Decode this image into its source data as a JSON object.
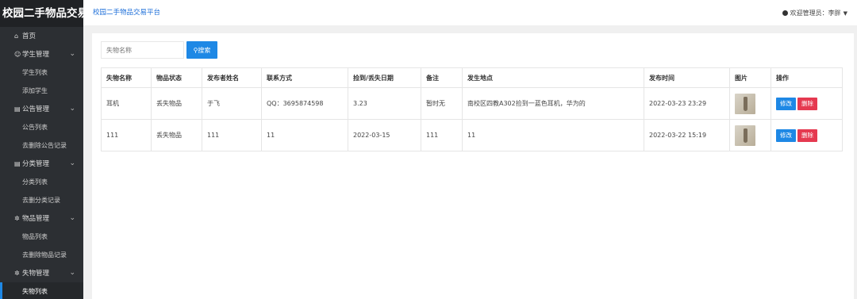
{
  "app": {
    "brand": "校园二手物品交易"
  },
  "topbar": {
    "crumb": "校园二手物品交易平台",
    "user": "欢迎管理员：李胖"
  },
  "sidebar": {
    "home": "首页",
    "groups": [
      {
        "label": "学生管理",
        "icon": "users-icon",
        "items": [
          "学生列表",
          "添加学生"
        ]
      },
      {
        "label": "公告管理",
        "icon": "document-icon",
        "items": [
          "公告列表",
          "去删除公告记录"
        ]
      },
      {
        "label": "分类管理",
        "icon": "document-icon",
        "items": [
          "分类列表",
          "去删分类记录"
        ]
      },
      {
        "label": "物品管理",
        "icon": "gear-icon",
        "items": [
          "物品列表",
          "去删除物品记录"
        ]
      },
      {
        "label": "失物管理",
        "icon": "gear-icon",
        "items": [
          "失物列表"
        ]
      }
    ],
    "active_item": "失物列表"
  },
  "search": {
    "placeholder": "失物名称",
    "button": "搜索"
  },
  "table": {
    "headers": [
      "失物名称",
      "物品状态",
      "发布者姓名",
      "联系方式",
      "捡到/丢失日期",
      "备注",
      "发生地点",
      "发布时间",
      "图片",
      "操作"
    ],
    "rows": [
      {
        "name": "耳机",
        "status": "丢失物品",
        "publisher": "于飞",
        "contact": "QQ：3695874598",
        "date": "3.23",
        "note": "暂时无",
        "place": "南校区四教A302捡到一蓝色耳机，华为的",
        "time": "2022-03-23 23:29"
      },
      {
        "name": "111",
        "status": "丢失物品",
        "publisher": "111",
        "contact": "11",
        "date": "2022-03-15",
        "note": "111",
        "place": "11",
        "time": "2022-03-22 15:19"
      }
    ],
    "edit_label": "修改",
    "delete_label": "删除"
  }
}
